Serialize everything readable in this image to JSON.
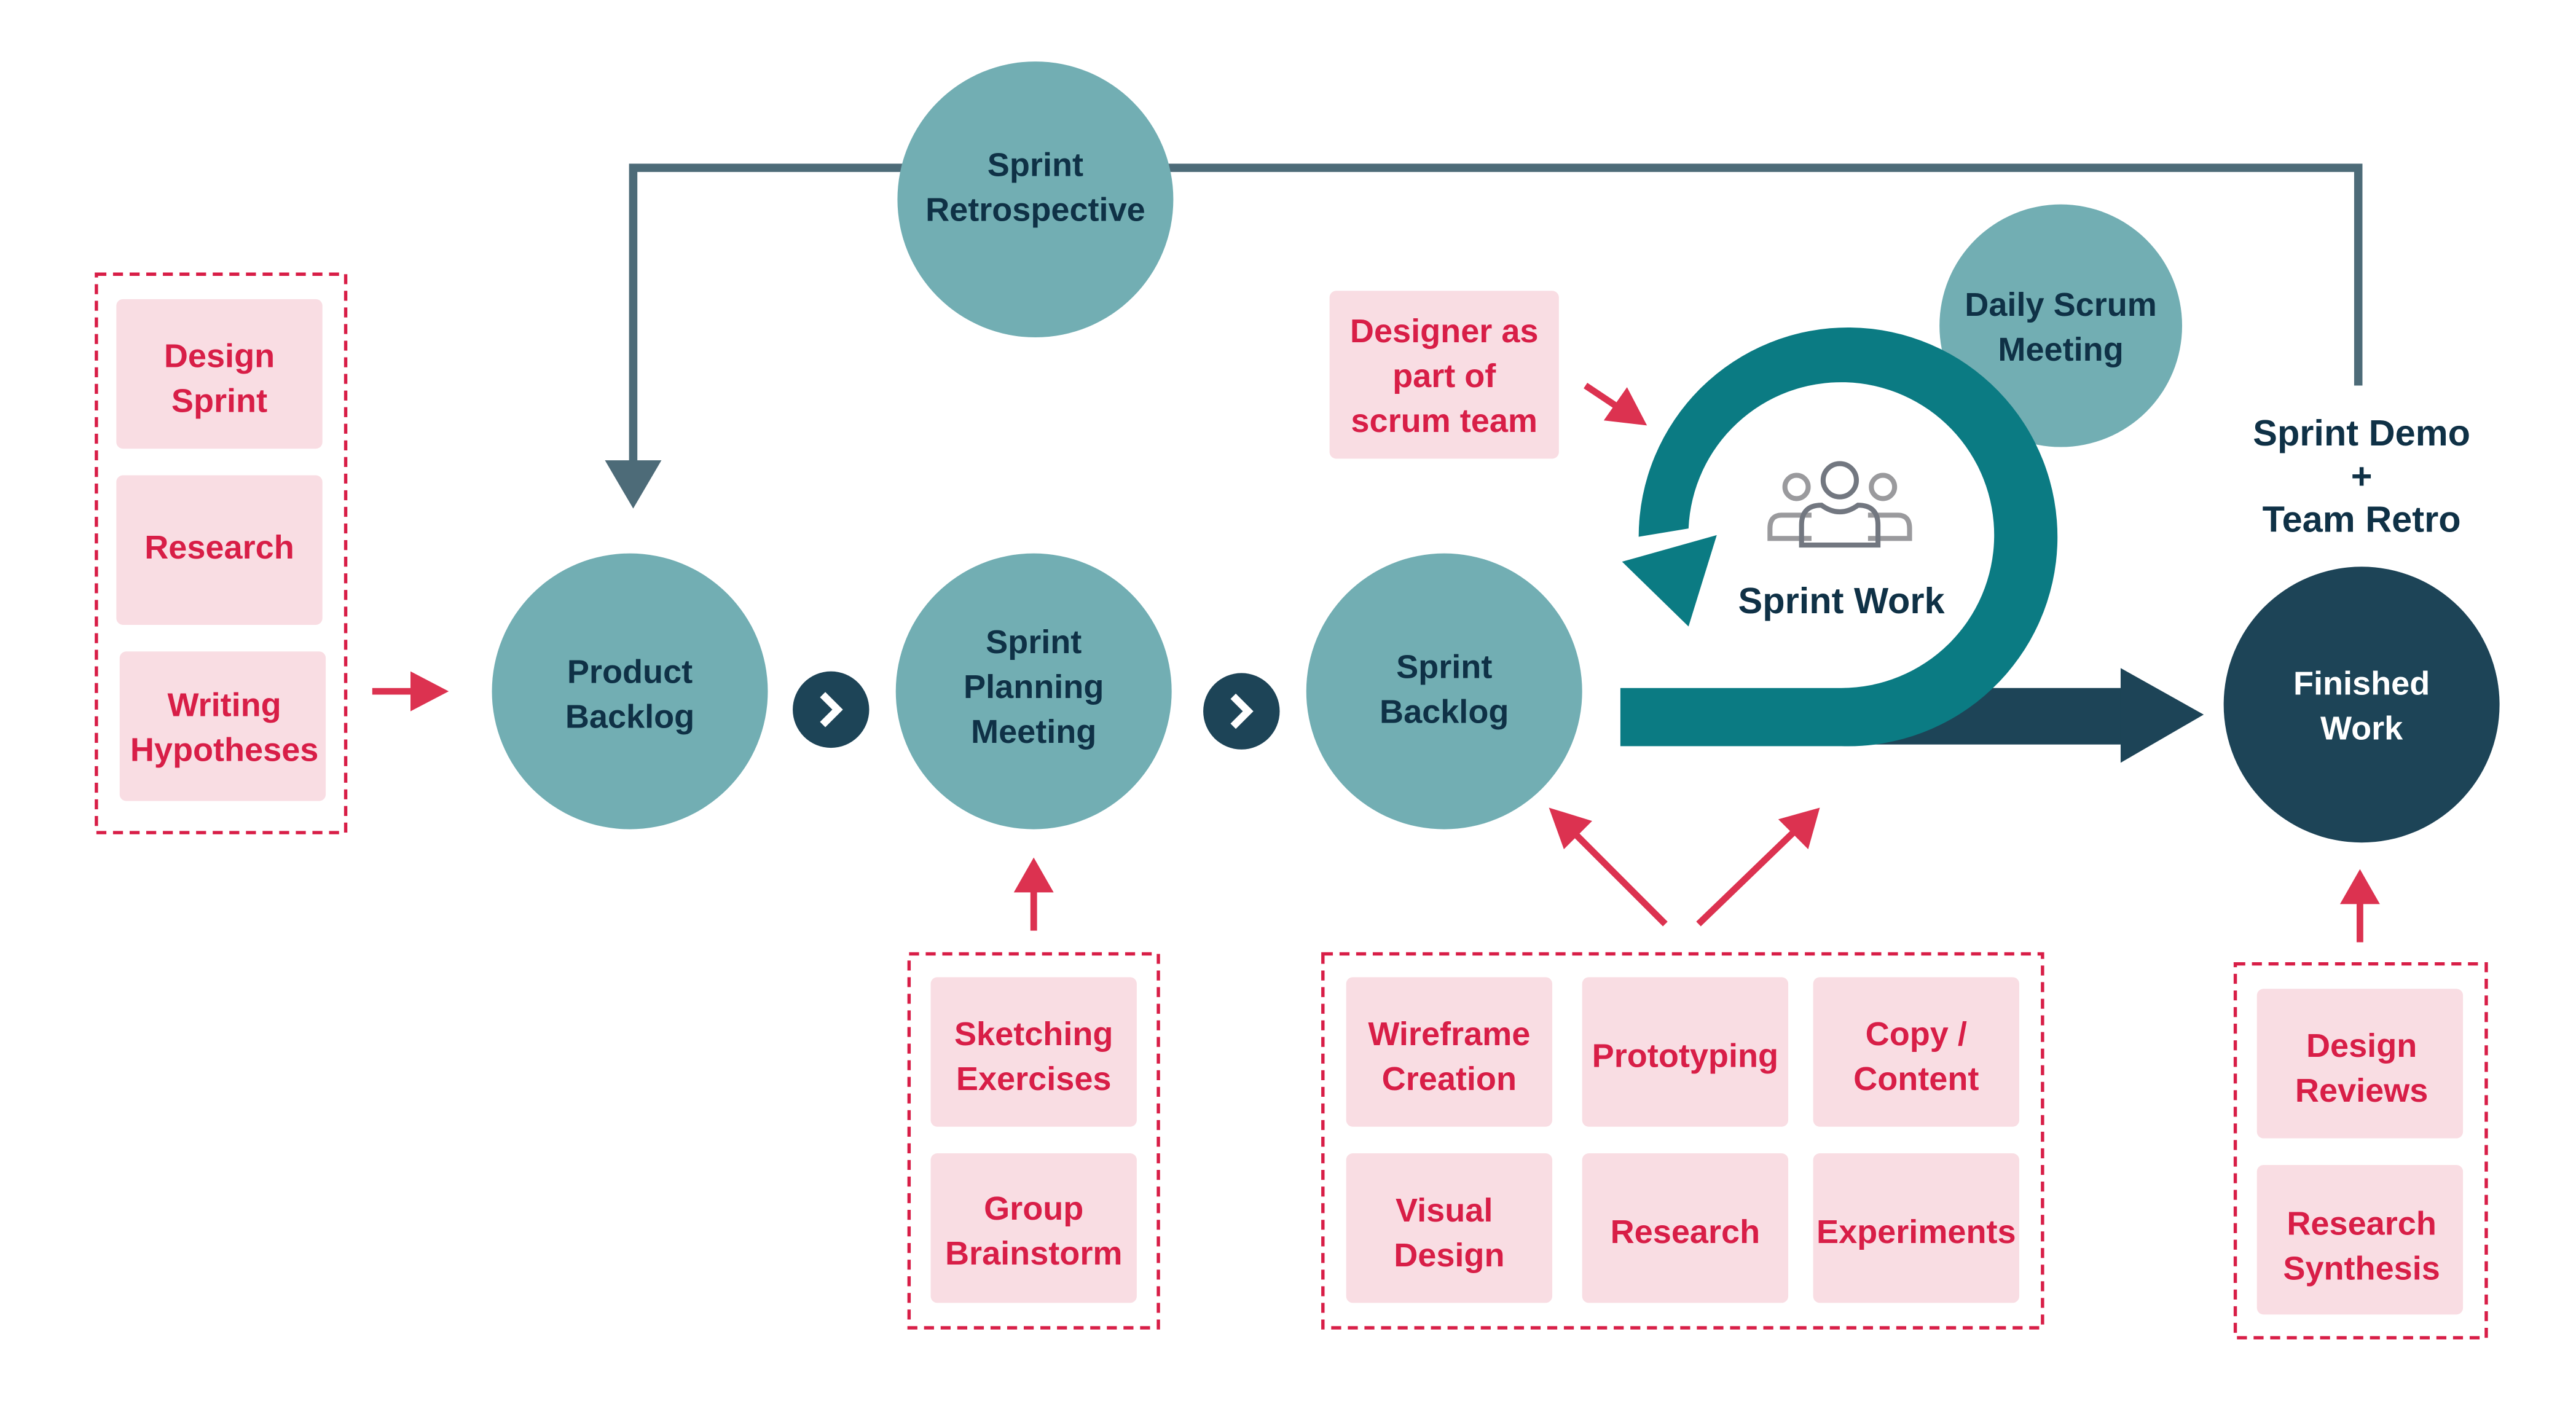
{
  "colors": {
    "node_teal": "#72aeb3",
    "node_dark": "#1d4457",
    "loop_teal": "#0b7b83",
    "feedback_line": "#4d6b78",
    "accent_red": "#d81e47",
    "box_pink": "#f9dde3",
    "text_dark": "#0f3146"
  },
  "nodes": {
    "retrospective": {
      "lines": [
        "Sprint",
        "Retrospective"
      ]
    },
    "product_backlog": {
      "lines": [
        "Product",
        "Backlog"
      ]
    },
    "planning": {
      "lines": [
        "Sprint",
        "Planning",
        "Meeting"
      ]
    },
    "sprint_backlog": {
      "lines": [
        "Sprint",
        "Backlog"
      ]
    },
    "daily_scrum": {
      "lines": [
        "Daily Scrum",
        "Meeting"
      ]
    },
    "sprint_work": {
      "label": "Sprint Work",
      "icon": "team-icon"
    },
    "finished_work": {
      "lines": [
        "Finished",
        "Work"
      ]
    },
    "sprint_demo": {
      "lines": [
        "Sprint Demo",
        "+",
        "Team Retro"
      ]
    }
  },
  "designer_note": {
    "lines": [
      "Designer as",
      "part of",
      "scrum team"
    ]
  },
  "groups": {
    "discovery": [
      {
        "lines": [
          "Design",
          "Sprint"
        ]
      },
      {
        "lines": [
          "Research"
        ]
      },
      {
        "lines": [
          "Writing",
          "Hypotheses"
        ]
      }
    ],
    "planning": [
      {
        "lines": [
          "Sketching",
          "Exercises"
        ]
      },
      {
        "lines": [
          "Group",
          "Brainstorm"
        ]
      }
    ],
    "sprint": [
      {
        "lines": [
          "Wireframe",
          "Creation"
        ]
      },
      {
        "lines": [
          "Prototyping"
        ]
      },
      {
        "lines": [
          "Copy /",
          "Content"
        ]
      },
      {
        "lines": [
          "Visual",
          "Design"
        ]
      },
      {
        "lines": [
          "Research"
        ]
      },
      {
        "lines": [
          "Experiments"
        ]
      }
    ],
    "review": [
      {
        "lines": [
          "Design",
          "Reviews"
        ]
      },
      {
        "lines": [
          "Research",
          "Synthesis"
        ]
      }
    ]
  },
  "connectors": {
    "next_icon": "chevron-right-icon"
  }
}
